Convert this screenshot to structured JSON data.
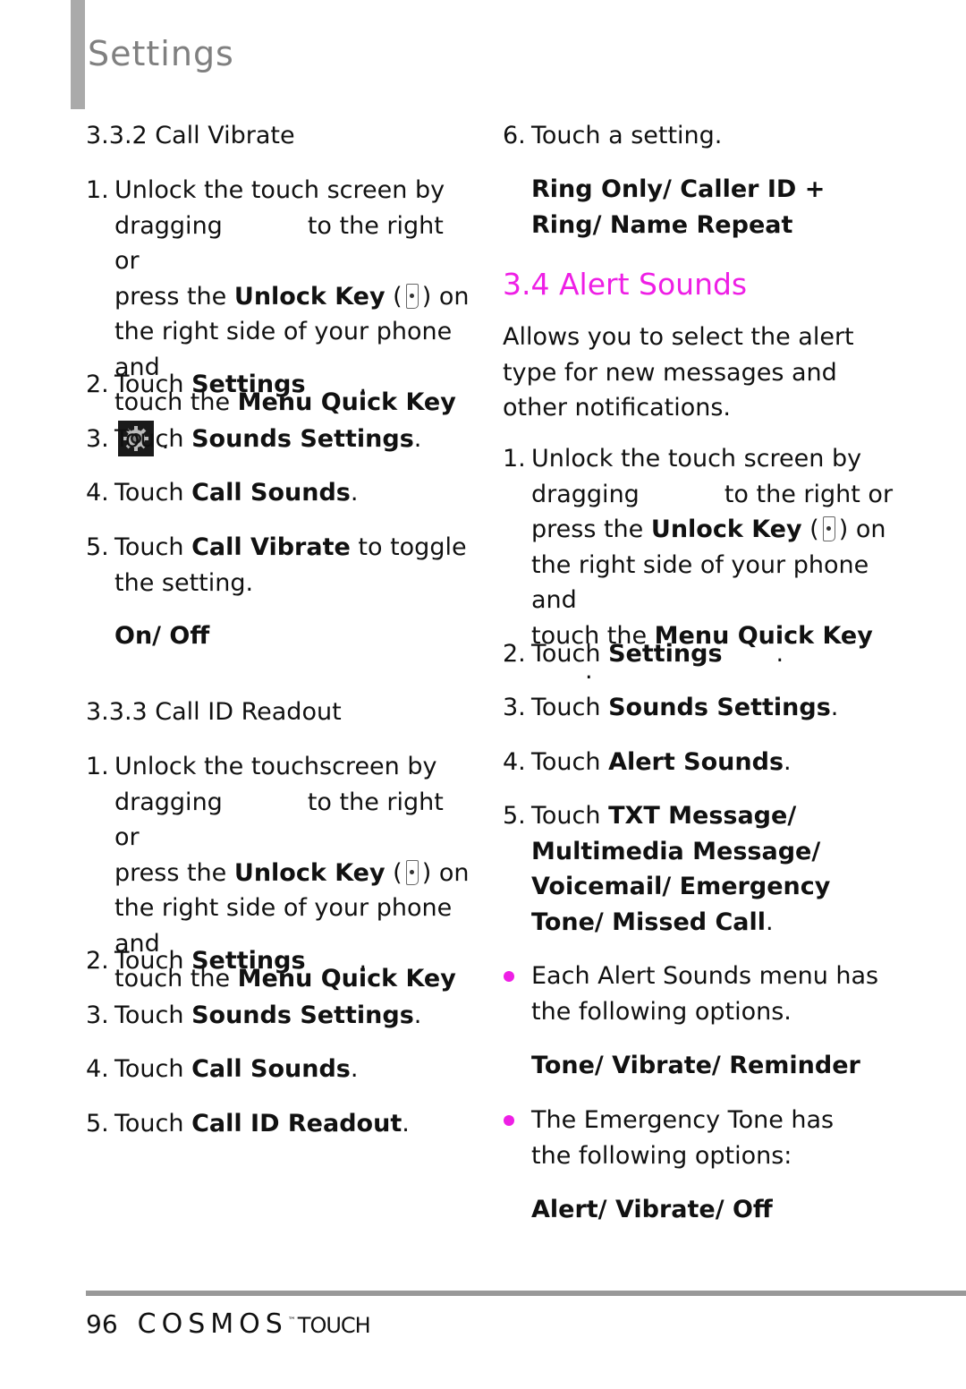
{
  "header": {
    "section_title": "Settings"
  },
  "left_column": {
    "call_vibrate": {
      "heading": "3.3.2 Call Vibrate",
      "step1": {
        "num": "1.",
        "line1": "Unlock the touch screen by",
        "dragging": "dragging",
        "to_right": "to the right or",
        "press_the": "press the",
        "unlock_key": "Unlock Key",
        "paren_open": "(",
        "paren_close": ") on",
        "line4": "the right side of your phone and",
        "touch_the": "touch the",
        "menu_quick_key": "Menu Quick Key",
        "period": "."
      },
      "step2": {
        "num": "2.",
        "touch": "Touch",
        "target": "Settings",
        "period": "."
      },
      "step3": {
        "num": "3.",
        "touch": "Touch",
        "target": "Sounds Settings",
        "period": "."
      },
      "step4": {
        "num": "4.",
        "touch": "Touch",
        "target": "Call Sounds",
        "period": "."
      },
      "step5": {
        "num": "5.",
        "touch": "Touch",
        "target": "Call Vibrate",
        "rest": "to toggle the setting."
      },
      "options": "On/ Off"
    },
    "call_id_readout": {
      "heading": "3.3.3 Call ID Readout",
      "step1": {
        "num": "1.",
        "line1": "Unlock the touchscreen by",
        "dragging": "dragging",
        "to_right": "to the right or",
        "press_the": "press the",
        "unlock_key": "Unlock Key",
        "paren_open": "(",
        "paren_close": ") on",
        "line4": "the right side of your phone and",
        "touch_the": "touch the",
        "menu_quick_key": "Menu Quick Key",
        "period": "."
      },
      "step2": {
        "num": "2.",
        "touch": "Touch",
        "target": "Settings",
        "period": "."
      },
      "step3": {
        "num": "3.",
        "touch": "Touch",
        "target": "Sounds Settings",
        "period": "."
      },
      "step4": {
        "num": "4.",
        "touch": "Touch",
        "target": "Call Sounds",
        "period": "."
      },
      "step5": {
        "num": "5.",
        "touch": "Touch",
        "target": "Call ID Readout",
        "period": "."
      }
    }
  },
  "right_column": {
    "step6": {
      "num": "6.",
      "text": "Touch a setting."
    },
    "call_id_options": "Ring Only/ Caller ID + Ring/ Name Repeat",
    "alert_sounds": {
      "heading": "3.4 Alert Sounds",
      "description": "Allows you to select the alert type for new messages and other notifications.",
      "step1": {
        "num": "1.",
        "line1": "Unlock the touch screen by",
        "dragging": "dragging",
        "to_right": "to the right or",
        "press_the": "press the",
        "unlock_key": "Unlock Key",
        "paren_open": "(",
        "paren_close": ") on",
        "line4": "the right side of your phone and",
        "touch_the": "touch the",
        "menu_quick_key": "Menu Quick Key",
        "period": "."
      },
      "step2": {
        "num": "2.",
        "touch": "Touch",
        "target": "Settings",
        "period": "."
      },
      "step3": {
        "num": "3.",
        "touch": "Touch",
        "target": "Sounds Settings",
        "period": "."
      },
      "step4": {
        "num": "4.",
        "touch": "Touch",
        "target": "Alert Sounds",
        "period": "."
      },
      "step5": {
        "num": "5.",
        "touch": "Touch",
        "target": "TXT Message/ Multimedia Message/ Voicemail/ Emergency Tone/ Missed Call",
        "period": "."
      },
      "bullet1": {
        "text": "Each Alert Sounds menu has the following options.",
        "options": "Tone/ Vibrate/ Reminder"
      },
      "bullet2": {
        "text": "The Emergency Tone has the following options:",
        "options": "Alert/ Vibrate/ Off"
      }
    }
  },
  "footer": {
    "page_number": "96",
    "brand": "COSMOS",
    "trademark": "™",
    "brand_suffix": "TOUCH"
  },
  "colors": {
    "accent": "#ee1fe5",
    "section_gray": "#808080",
    "rule_gray": "#999999"
  }
}
